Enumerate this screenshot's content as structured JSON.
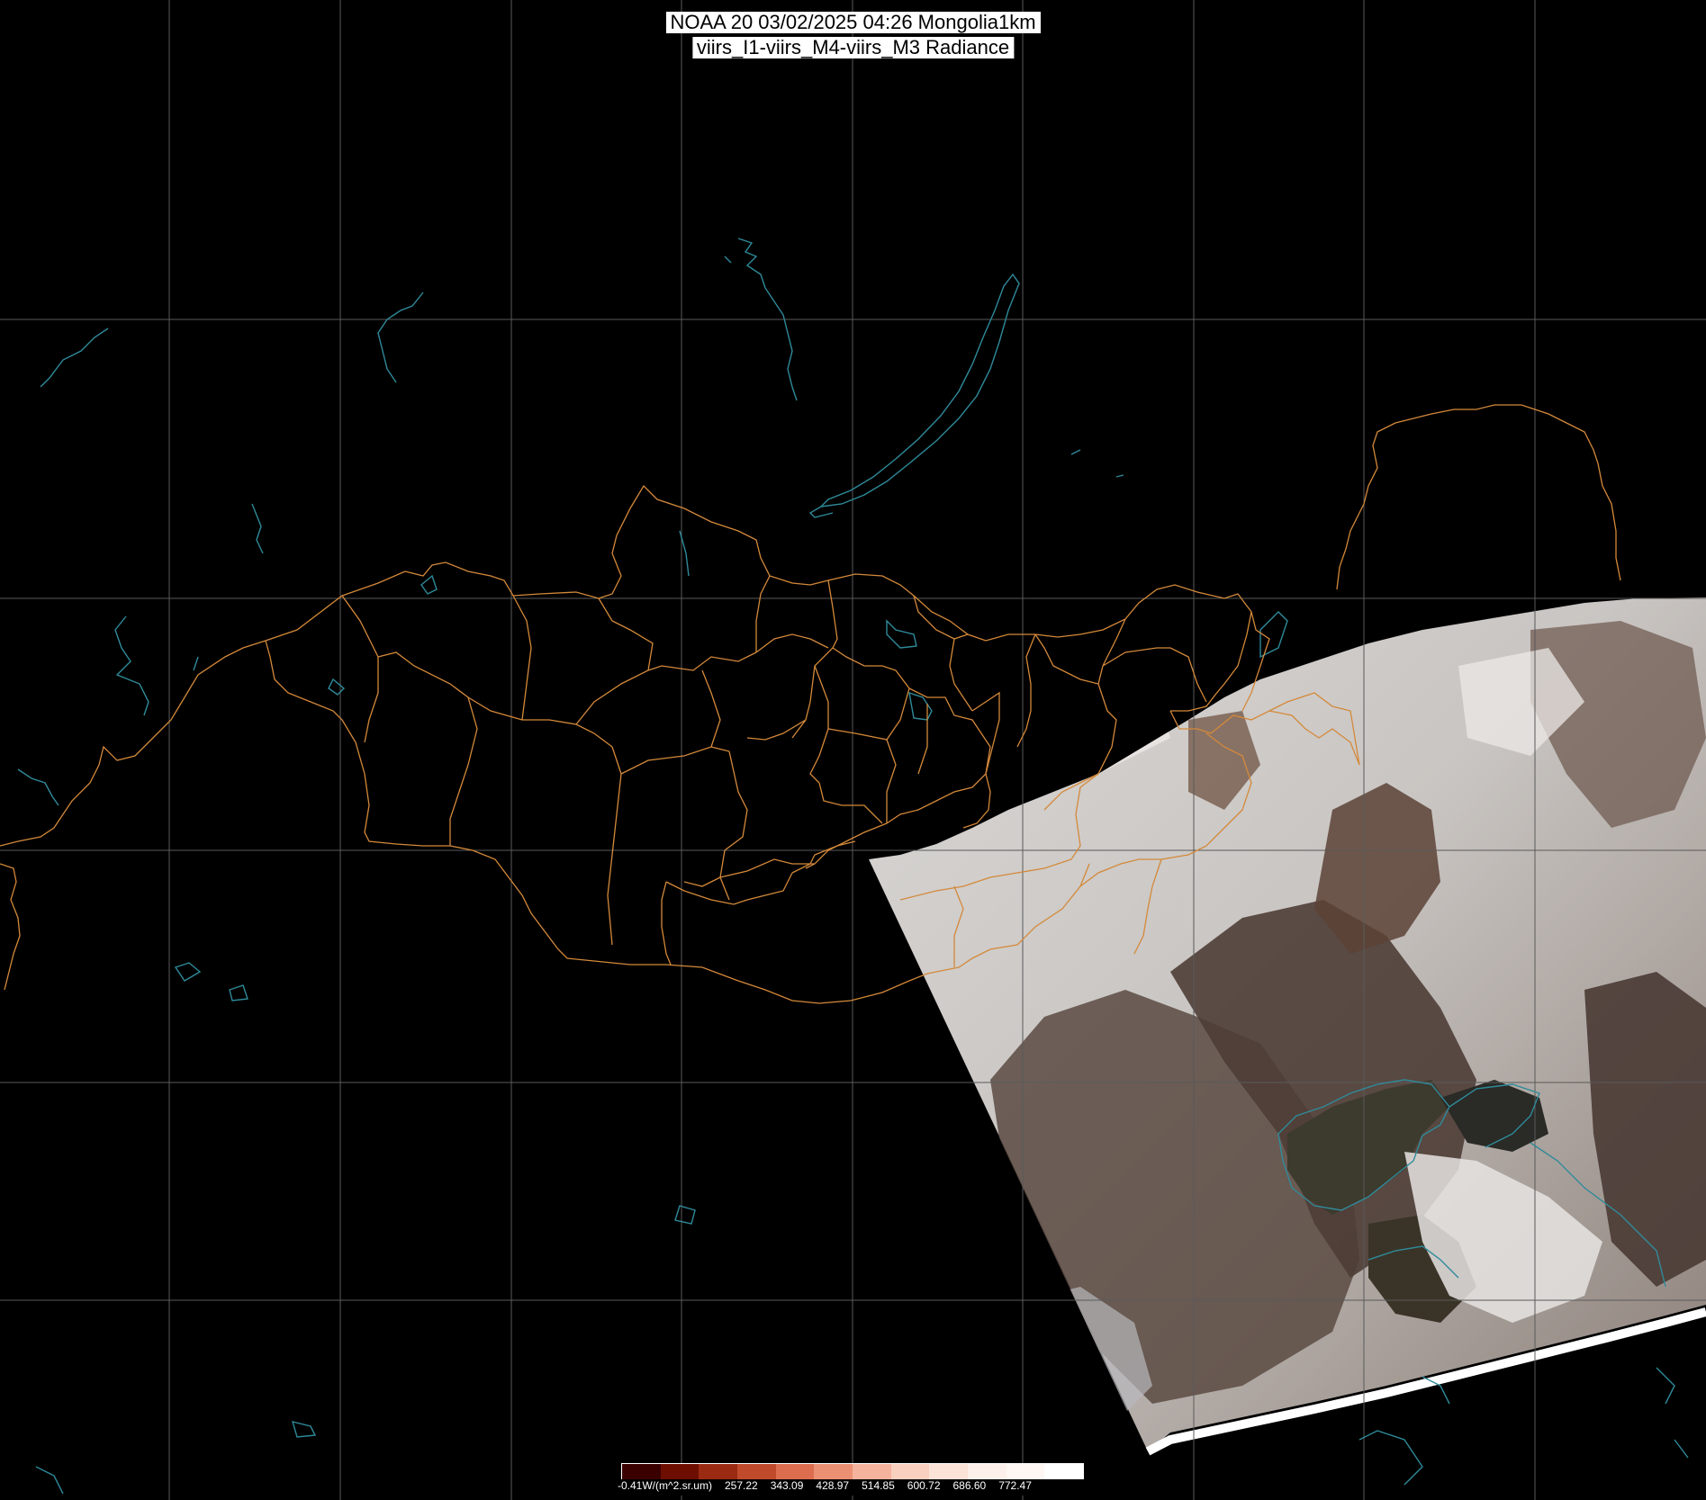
{
  "title": {
    "line1": "NOAA 20 03/02/2025 04:26 Mongolia1km",
    "line2": "viirs_I1-viirs_M4-viirs_M3 Radiance"
  },
  "colorbar": {
    "colors": [
      "#3a0000",
      "#6e0e00",
      "#9a2a12",
      "#c04a2c",
      "#dc6d4f",
      "#ec9074",
      "#f5b39d",
      "#f9cfbf",
      "#fbe3d8",
      "#fdf0ea",
      "#fef7f3",
      "#ffffff"
    ],
    "labels": [
      "-0.41W/(m^2.sr.um)",
      "257.22",
      "343.09",
      "428.97",
      "514.85",
      "600.72",
      "686.60",
      "772.47"
    ]
  },
  "colors": {
    "background": "#000000",
    "grid": "#5a5a5a",
    "borders": "#d4893a",
    "water": "#2f8a9a",
    "snow": "#e8e8e6",
    "land": "#4a3a34"
  }
}
